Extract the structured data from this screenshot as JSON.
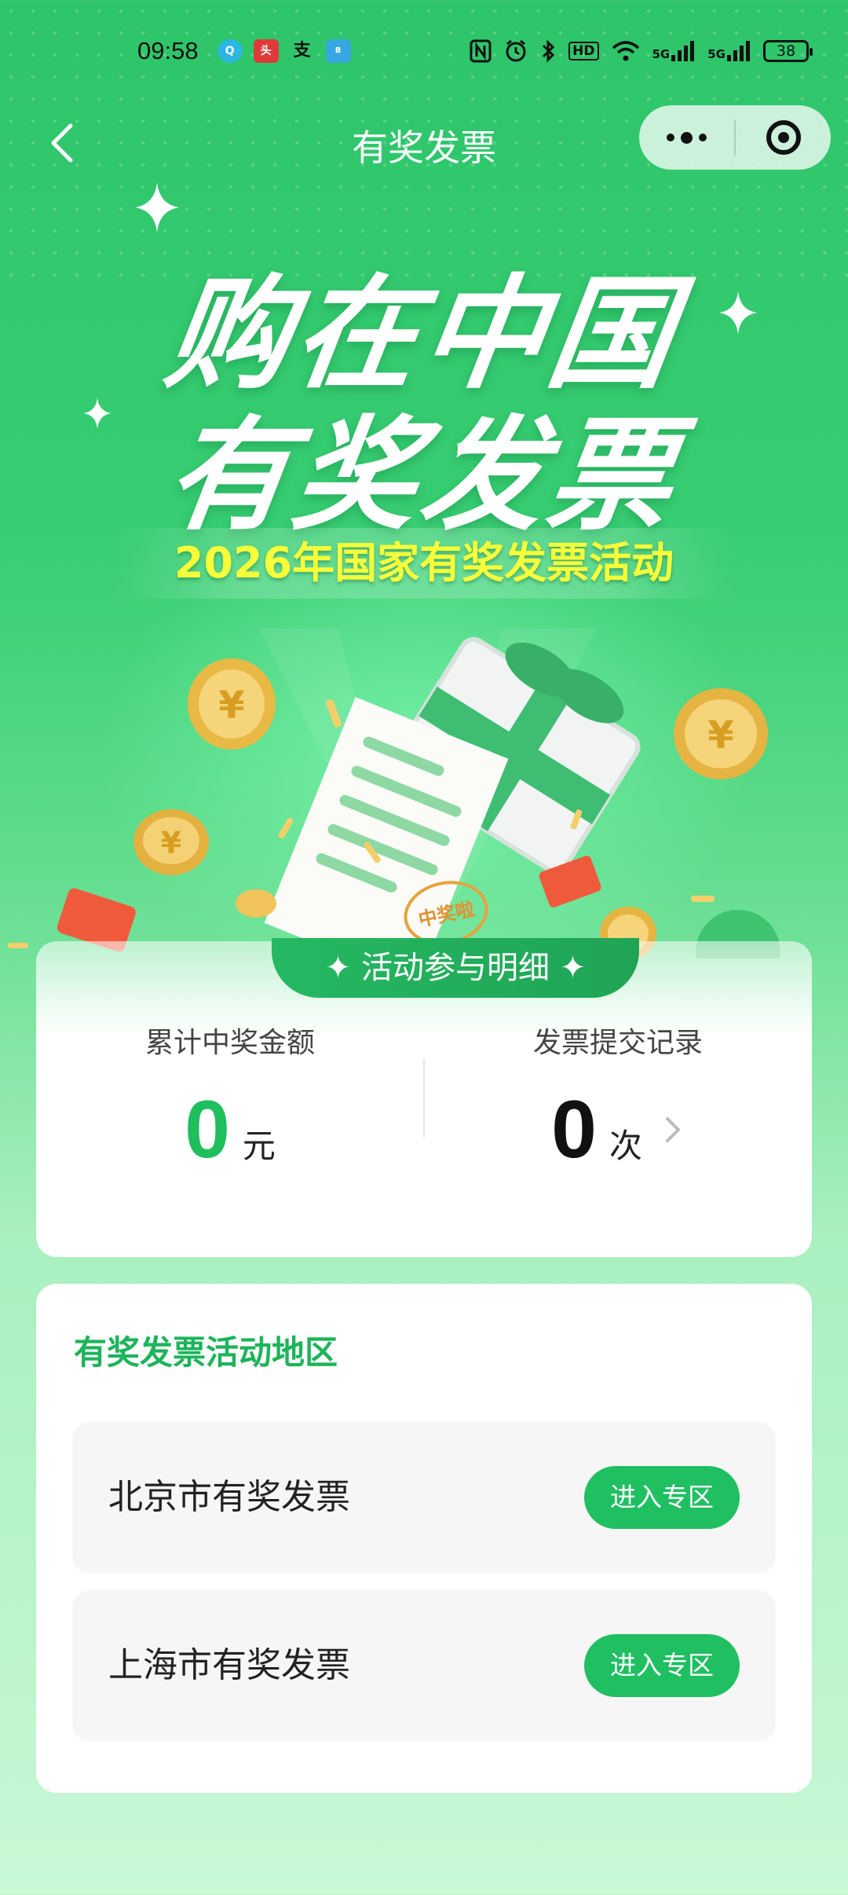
{
  "status_bar": {
    "time": "09:58",
    "battery": "38",
    "network_1": "5G",
    "network_2": "5G",
    "hd_label": "HD",
    "icons": [
      "nfc-icon",
      "alarm-icon",
      "bluetooth-icon",
      "hd-icon",
      "wifi-icon",
      "signal-icon",
      "signal-icon",
      "battery-icon"
    ],
    "notification_icons": [
      "qq-browser-icon",
      "toutiao-icon",
      "alipay-icon",
      "boss-icon"
    ]
  },
  "nav": {
    "title": "有奖发票"
  },
  "hero": {
    "line1": "购在中国",
    "line2": "有奖发票",
    "subtitle": "2026年国家有奖发票活动",
    "receipt_stamp": "中奖啦"
  },
  "stats": {
    "tab_label": "活动参与明细",
    "won_label": "累计中奖金额",
    "won_value": "0",
    "won_unit": "元",
    "records_label": "发票提交记录",
    "records_value": "0",
    "records_unit": "次"
  },
  "regions": {
    "title": "有奖发票活动地区",
    "items": [
      {
        "name": "北京市有奖发票",
        "button": "进入专区"
      },
      {
        "name": "上海市有奖发票",
        "button": "进入专区"
      }
    ]
  },
  "colors": {
    "brand_green": "#1fbf5d",
    "subtitle_yellow": "#f6ff3a",
    "region_title_green": "#1db45a"
  }
}
